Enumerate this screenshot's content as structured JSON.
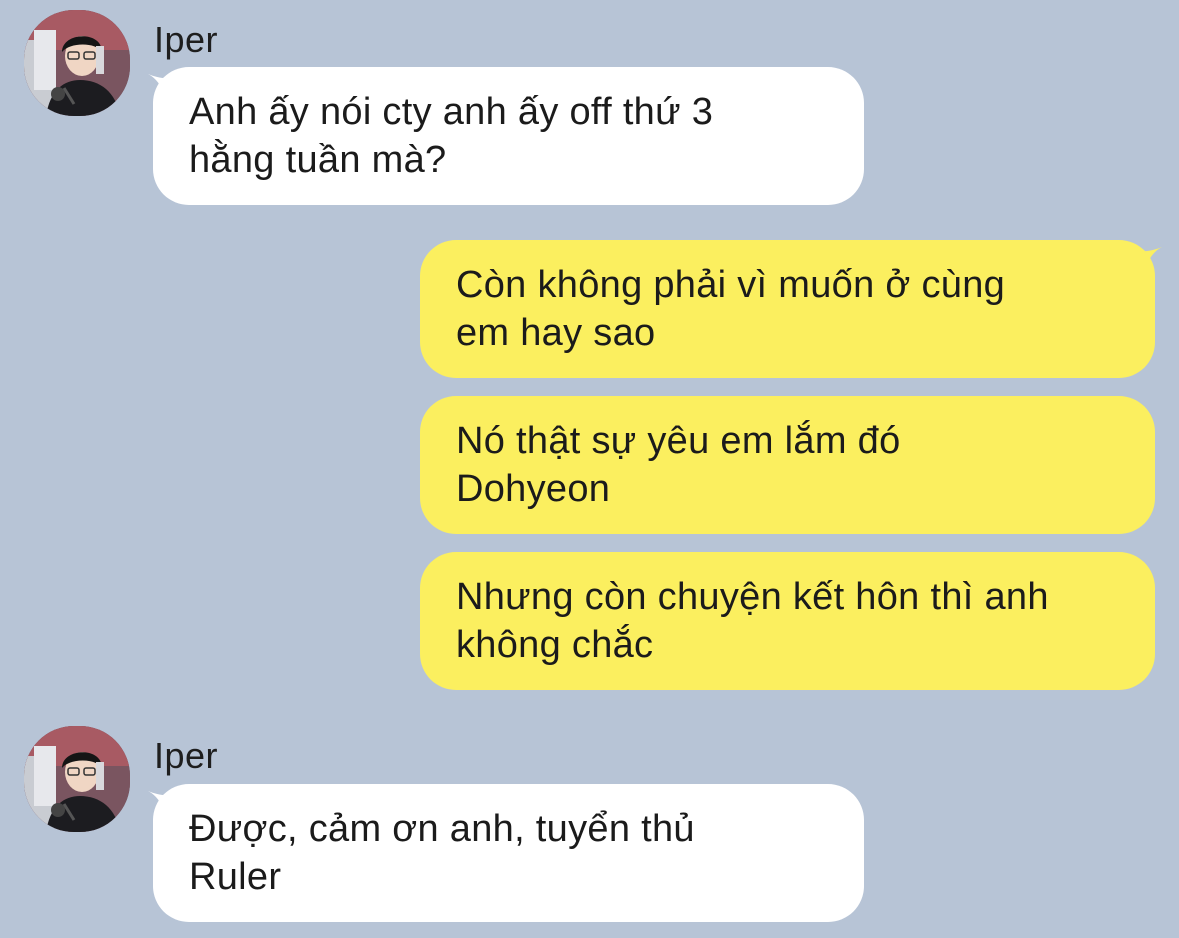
{
  "colors": {
    "background": "#b7c4d6",
    "incoming_bubble": "#ffffff",
    "outgoing_bubble": "#fbef5f"
  },
  "messages": [
    {
      "direction": "incoming",
      "sender": "Iper",
      "avatar_icon": "profile-photo-avatar",
      "lines": [
        "Anh ấy nói cty anh ấy off thứ 3",
        "hằng tuần mà?"
      ]
    },
    {
      "direction": "outgoing",
      "lines": [
        "Còn không phải vì muốn ở cùng",
        "em hay sao"
      ]
    },
    {
      "direction": "outgoing",
      "lines": [
        "Nó thật sự yêu em lắm đó",
        "Dohyeon"
      ]
    },
    {
      "direction": "outgoing",
      "lines": [
        "Nhưng còn chuyện kết hôn thì anh",
        "không chắc"
      ]
    },
    {
      "direction": "incoming",
      "sender": "Iper",
      "avatar_icon": "profile-photo-avatar",
      "lines": [
        "Được, cảm ơn anh, tuyển thủ",
        "Ruler"
      ]
    }
  ]
}
